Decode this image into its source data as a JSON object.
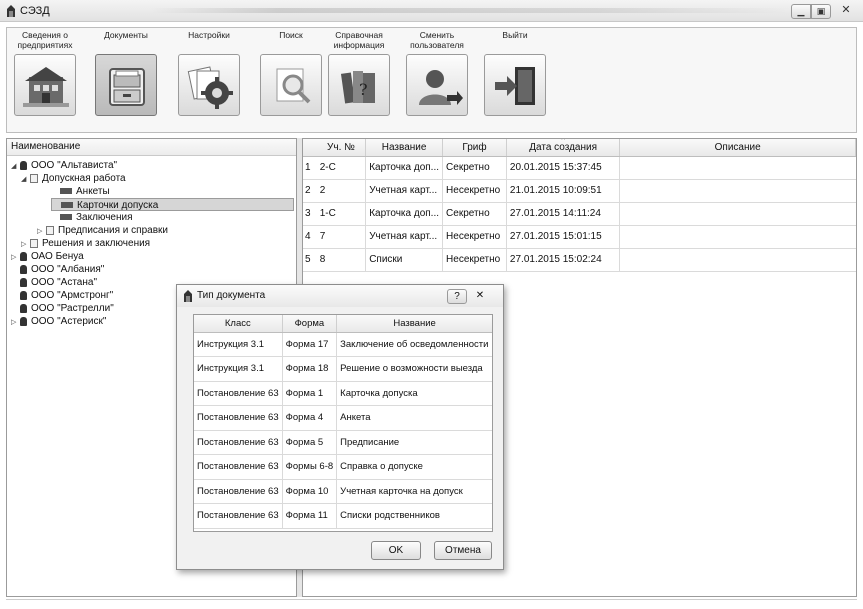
{
  "window": {
    "title": "СЭЗД"
  },
  "toolbar": {
    "items": [
      {
        "label": "Сведения о\nпредприятиях",
        "icon": "company-building-icon"
      },
      {
        "label": "Документы",
        "icon": "document-drawer-icon"
      },
      {
        "label": "Настройки",
        "icon": "settings-gear-icon"
      },
      {
        "label": "Поиск",
        "icon": "search-magnifier-icon"
      },
      {
        "label": "Справочная\nинформация",
        "icon": "reference-books-icon"
      },
      {
        "label": "Сменить\nпользователя",
        "icon": "switch-user-icon"
      },
      {
        "label": "Выйти",
        "icon": "exit-door-icon"
      }
    ]
  },
  "tree": {
    "header": "Наименование",
    "nodes": [
      {
        "label": "ООО \"Альтависта\"",
        "icon": "organization-icon",
        "arrow": "◢"
      },
      {
        "label": "Допускная работа",
        "icon": "folder-doc-icon",
        "arrow": "◢"
      },
      {
        "label": "Анкеты",
        "icon": "leaf-icon",
        "arrow": ""
      },
      {
        "label": "Карточки допуска",
        "icon": "leaf-icon",
        "arrow": "",
        "selected": true
      },
      {
        "label": "Заключения",
        "icon": "leaf-icon",
        "arrow": ""
      },
      {
        "label": "Предписания и справки",
        "icon": "folder-doc-icon",
        "arrow": "▷"
      },
      {
        "label": "Решения и заключения",
        "icon": "folder-doc-icon",
        "arrow": "▷"
      },
      {
        "label": "ОАО Бенуа",
        "icon": "organization-icon",
        "arrow": "▷"
      },
      {
        "label": "ООО \"Албания\"",
        "icon": "organization-icon",
        "arrow": ""
      },
      {
        "label": "ООО \"Астана\"",
        "icon": "organization-icon",
        "arrow": ""
      },
      {
        "label": "ООО \"Армстронг\"",
        "icon": "organization-icon",
        "arrow": ""
      },
      {
        "label": "ООО \"Растрелли\"",
        "icon": "organization-icon",
        "arrow": ""
      },
      {
        "label": "ООО \"Астериск\"",
        "icon": "organization-icon",
        "arrow": "▷"
      }
    ]
  },
  "grid": {
    "columns": [
      "Уч. №",
      "Название",
      "Гриф",
      "Дата создания",
      "Описание"
    ],
    "rows": [
      {
        "n": "1",
        "num": "2-С",
        "name": "Карточка доп...",
        "grif": "Секретно",
        "date": "20.01.2015 15:37:45",
        "desc": ""
      },
      {
        "n": "2",
        "num": "2",
        "name": "Учетная карт...",
        "grif": "Несекретно",
        "date": "21.01.2015 10:09:51",
        "desc": ""
      },
      {
        "n": "3",
        "num": "1-С",
        "name": "Карточка доп...",
        "grif": "Секретно",
        "date": "27.01.2015 14:11:24",
        "desc": ""
      },
      {
        "n": "4",
        "num": "7",
        "name": "Учетная карт...",
        "grif": "Несекретно",
        "date": "27.01.2015 15:01:15",
        "desc": ""
      },
      {
        "n": "5",
        "num": "8",
        "name": "Списки",
        "grif": "Несекретно",
        "date": "27.01.2015 15:02:24",
        "desc": ""
      }
    ]
  },
  "dialog": {
    "title": "Тип документа",
    "help": "?",
    "close": "✕",
    "columns": [
      "Класс",
      "Форма",
      "Название"
    ],
    "rows": [
      {
        "cls": "Инструкция 3.1",
        "form": "Форма 17",
        "name": "Заключение об осведомленности"
      },
      {
        "cls": "Инструкция 3.1",
        "form": "Форма 18",
        "name": "Решение о возможности выезда"
      },
      {
        "cls": "Постановление 63",
        "form": "Форма 1",
        "name": "Карточка допуска"
      },
      {
        "cls": "Постановление 63",
        "form": "Форма 4",
        "name": "Анкета"
      },
      {
        "cls": "Постановление 63",
        "form": "Форма 5",
        "name": "Предписание"
      },
      {
        "cls": "Постановление 63",
        "form": "Формы 6-8",
        "name": "Справка о допуске"
      },
      {
        "cls": "Постановление 63",
        "form": "Форма 10",
        "name": "Учетная карточка на допуск"
      },
      {
        "cls": "Постановление 63",
        "form": "Форма 11",
        "name": "Списки родственников"
      }
    ],
    "ok": "OK",
    "cancel": "Отмена"
  }
}
